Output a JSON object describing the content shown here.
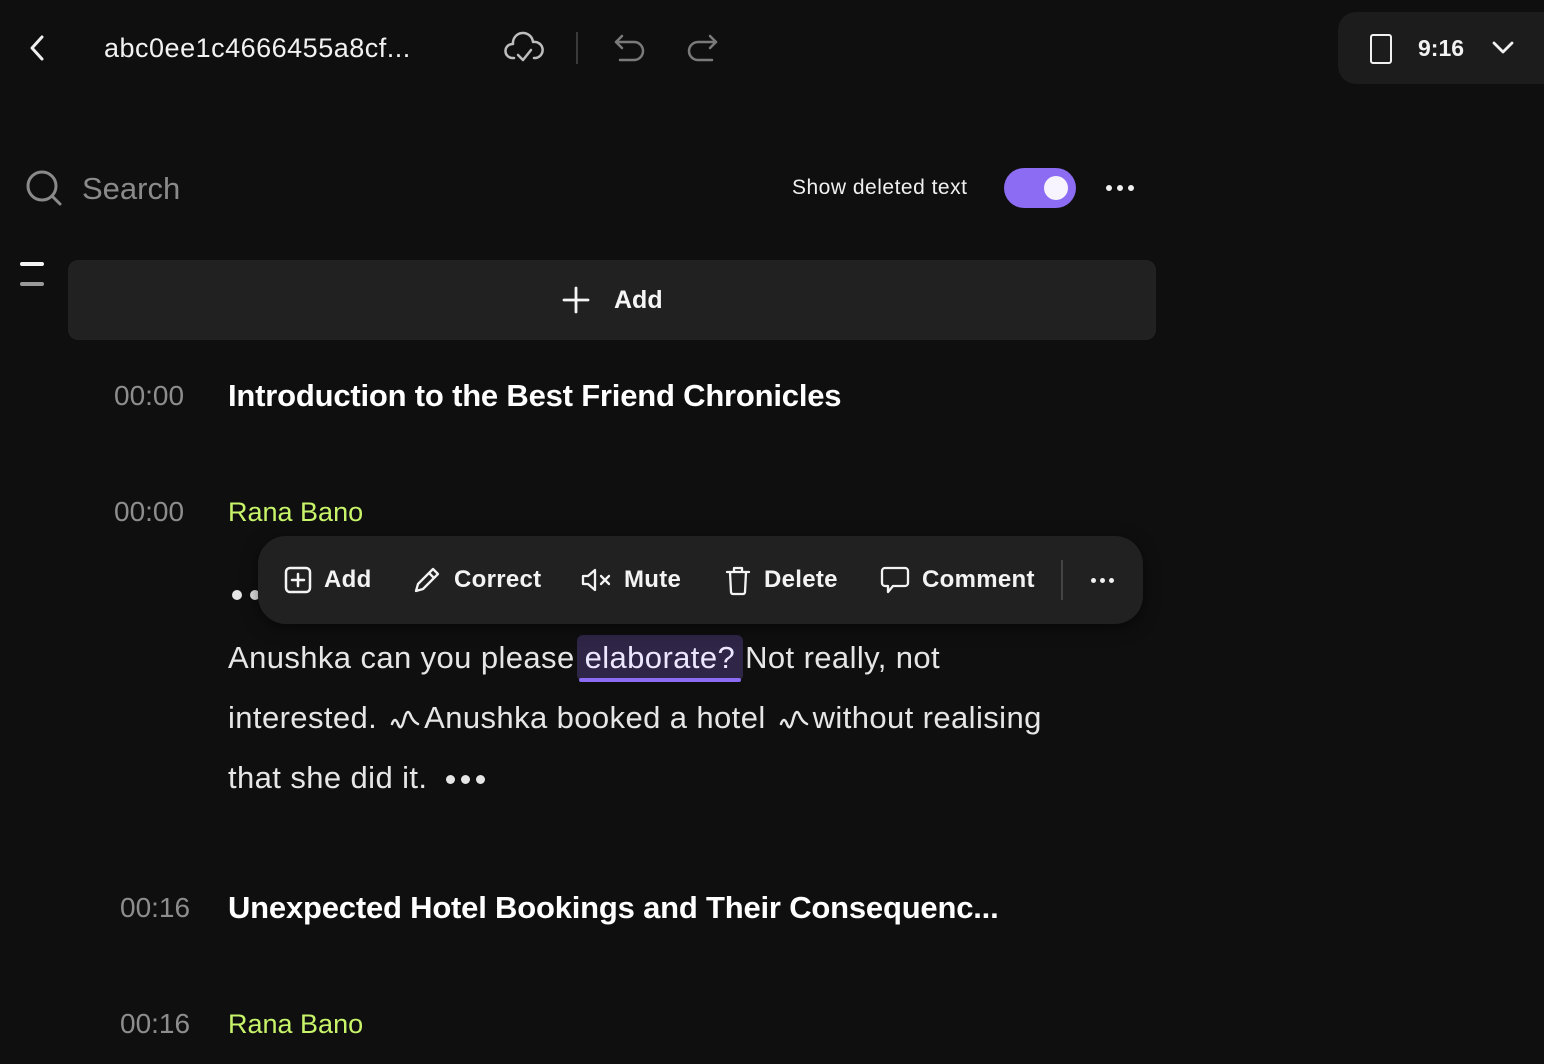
{
  "header": {
    "back_icon": "chevron-left-icon",
    "title": "abc0ee1c4666455a8cf...",
    "sync_icon": "cloud-check-icon",
    "undo_icon": "undo-icon",
    "redo_icon": "redo-icon",
    "aspect_ratio": {
      "icon": "portrait-frame-icon",
      "value": "9:16",
      "dropdown_icon": "chevron-down-icon"
    }
  },
  "toolbar": {
    "search_placeholder": "Search",
    "search_value": "",
    "show_deleted_label": "Show deleted text",
    "show_deleted_on": true,
    "more_icon": "more-horizontal-icon"
  },
  "add_bar": {
    "icon": "plus-icon",
    "label": "Add"
  },
  "transcript": [
    {
      "type": "chapter",
      "timestamp": "00:00",
      "title": "Introduction to the Best Friend Chronicles"
    },
    {
      "type": "speaker",
      "timestamp": "00:00",
      "speaker": "Rana Bano",
      "segments": {
        "before_highlight": "Anushka can you please",
        "highlight": "elaborate?",
        "after_highlight_1": "Not really, not interested.",
        "after_pause_1": "Anushka booked a hotel",
        "after_pause_2": "without realising that she did it."
      }
    },
    {
      "type": "chapter",
      "timestamp": "00:16",
      "title": "Unexpected Hotel Bookings and Their Consequenc..."
    },
    {
      "type": "speaker",
      "timestamp": "00:16",
      "speaker": "Rana Bano"
    }
  ],
  "context_menu": {
    "items": [
      {
        "label": "Add",
        "icon": "plus-square-icon"
      },
      {
        "label": "Correct",
        "icon": "pencil-icon"
      },
      {
        "label": "Mute",
        "icon": "speaker-mute-icon"
      },
      {
        "label": "Delete",
        "icon": "trash-icon"
      },
      {
        "label": "Comment",
        "icon": "comment-icon"
      }
    ],
    "more_icon": "more-horizontal-icon"
  },
  "colors": {
    "background": "#0f0f0f",
    "accent": "#8b6cf2",
    "speaker": "#c8f46a",
    "highlight_bg": "#2f2647"
  }
}
